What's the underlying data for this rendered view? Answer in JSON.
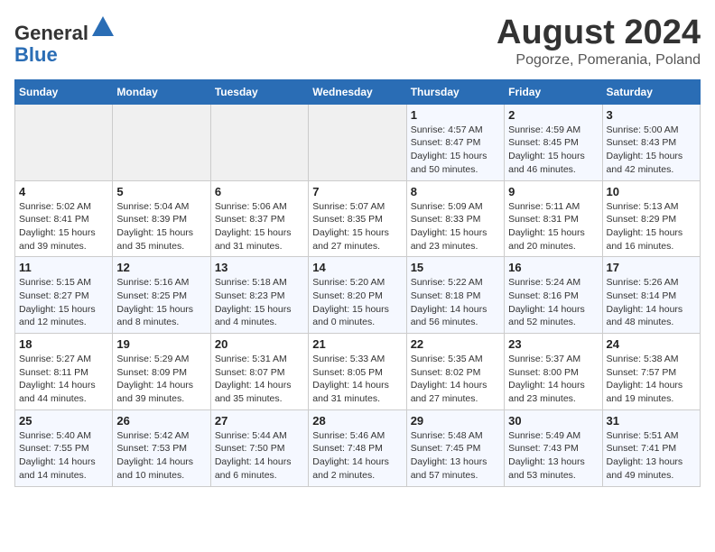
{
  "header": {
    "logo_line1": "General",
    "logo_line2": "Blue",
    "title": "August 2024",
    "subtitle": "Pogorze, Pomerania, Poland"
  },
  "days_of_week": [
    "Sunday",
    "Monday",
    "Tuesday",
    "Wednesday",
    "Thursday",
    "Friday",
    "Saturday"
  ],
  "weeks": [
    [
      {
        "day": "",
        "content": ""
      },
      {
        "day": "",
        "content": ""
      },
      {
        "day": "",
        "content": ""
      },
      {
        "day": "",
        "content": ""
      },
      {
        "day": "1",
        "content": "Sunrise: 4:57 AM\nSunset: 8:47 PM\nDaylight: 15 hours\nand 50 minutes."
      },
      {
        "day": "2",
        "content": "Sunrise: 4:59 AM\nSunset: 8:45 PM\nDaylight: 15 hours\nand 46 minutes."
      },
      {
        "day": "3",
        "content": "Sunrise: 5:00 AM\nSunset: 8:43 PM\nDaylight: 15 hours\nand 42 minutes."
      }
    ],
    [
      {
        "day": "4",
        "content": "Sunrise: 5:02 AM\nSunset: 8:41 PM\nDaylight: 15 hours\nand 39 minutes."
      },
      {
        "day": "5",
        "content": "Sunrise: 5:04 AM\nSunset: 8:39 PM\nDaylight: 15 hours\nand 35 minutes."
      },
      {
        "day": "6",
        "content": "Sunrise: 5:06 AM\nSunset: 8:37 PM\nDaylight: 15 hours\nand 31 minutes."
      },
      {
        "day": "7",
        "content": "Sunrise: 5:07 AM\nSunset: 8:35 PM\nDaylight: 15 hours\nand 27 minutes."
      },
      {
        "day": "8",
        "content": "Sunrise: 5:09 AM\nSunset: 8:33 PM\nDaylight: 15 hours\nand 23 minutes."
      },
      {
        "day": "9",
        "content": "Sunrise: 5:11 AM\nSunset: 8:31 PM\nDaylight: 15 hours\nand 20 minutes."
      },
      {
        "day": "10",
        "content": "Sunrise: 5:13 AM\nSunset: 8:29 PM\nDaylight: 15 hours\nand 16 minutes."
      }
    ],
    [
      {
        "day": "11",
        "content": "Sunrise: 5:15 AM\nSunset: 8:27 PM\nDaylight: 15 hours\nand 12 minutes."
      },
      {
        "day": "12",
        "content": "Sunrise: 5:16 AM\nSunset: 8:25 PM\nDaylight: 15 hours\nand 8 minutes."
      },
      {
        "day": "13",
        "content": "Sunrise: 5:18 AM\nSunset: 8:23 PM\nDaylight: 15 hours\nand 4 minutes."
      },
      {
        "day": "14",
        "content": "Sunrise: 5:20 AM\nSunset: 8:20 PM\nDaylight: 15 hours\nand 0 minutes."
      },
      {
        "day": "15",
        "content": "Sunrise: 5:22 AM\nSunset: 8:18 PM\nDaylight: 14 hours\nand 56 minutes."
      },
      {
        "day": "16",
        "content": "Sunrise: 5:24 AM\nSunset: 8:16 PM\nDaylight: 14 hours\nand 52 minutes."
      },
      {
        "day": "17",
        "content": "Sunrise: 5:26 AM\nSunset: 8:14 PM\nDaylight: 14 hours\nand 48 minutes."
      }
    ],
    [
      {
        "day": "18",
        "content": "Sunrise: 5:27 AM\nSunset: 8:11 PM\nDaylight: 14 hours\nand 44 minutes."
      },
      {
        "day": "19",
        "content": "Sunrise: 5:29 AM\nSunset: 8:09 PM\nDaylight: 14 hours\nand 39 minutes."
      },
      {
        "day": "20",
        "content": "Sunrise: 5:31 AM\nSunset: 8:07 PM\nDaylight: 14 hours\nand 35 minutes."
      },
      {
        "day": "21",
        "content": "Sunrise: 5:33 AM\nSunset: 8:05 PM\nDaylight: 14 hours\nand 31 minutes."
      },
      {
        "day": "22",
        "content": "Sunrise: 5:35 AM\nSunset: 8:02 PM\nDaylight: 14 hours\nand 27 minutes."
      },
      {
        "day": "23",
        "content": "Sunrise: 5:37 AM\nSunset: 8:00 PM\nDaylight: 14 hours\nand 23 minutes."
      },
      {
        "day": "24",
        "content": "Sunrise: 5:38 AM\nSunset: 7:57 PM\nDaylight: 14 hours\nand 19 minutes."
      }
    ],
    [
      {
        "day": "25",
        "content": "Sunrise: 5:40 AM\nSunset: 7:55 PM\nDaylight: 14 hours\nand 14 minutes."
      },
      {
        "day": "26",
        "content": "Sunrise: 5:42 AM\nSunset: 7:53 PM\nDaylight: 14 hours\nand 10 minutes."
      },
      {
        "day": "27",
        "content": "Sunrise: 5:44 AM\nSunset: 7:50 PM\nDaylight: 14 hours\nand 6 minutes."
      },
      {
        "day": "28",
        "content": "Sunrise: 5:46 AM\nSunset: 7:48 PM\nDaylight: 14 hours\nand 2 minutes."
      },
      {
        "day": "29",
        "content": "Sunrise: 5:48 AM\nSunset: 7:45 PM\nDaylight: 13 hours\nand 57 minutes."
      },
      {
        "day": "30",
        "content": "Sunrise: 5:49 AM\nSunset: 7:43 PM\nDaylight: 13 hours\nand 53 minutes."
      },
      {
        "day": "31",
        "content": "Sunrise: 5:51 AM\nSunset: 7:41 PM\nDaylight: 13 hours\nand 49 minutes."
      }
    ]
  ]
}
